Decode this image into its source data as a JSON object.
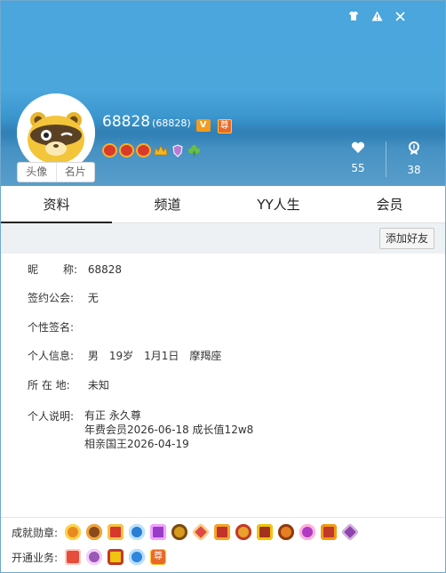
{
  "header": {
    "nickname": "68828",
    "yy_id": "(68828)",
    "v_badge": "V",
    "zun_badge": "尊",
    "likes": "55",
    "fans": "38",
    "avatar_tab_label": "头像",
    "card_tab_label": "名片"
  },
  "tabs": [
    "资料",
    "频道",
    "YY人生",
    "会员"
  ],
  "toolbar": {
    "add_friend_label": "添加好友"
  },
  "profile": {
    "nickname_label": "昵称：",
    "nickname_label_a": "昵",
    "nickname_label_b": "称:",
    "nickname_value": "68828",
    "guild_label": "签约公会:",
    "guild_value": "无",
    "signature_label": "个性签名:",
    "signature_value": "",
    "personal_label": "个人信息:",
    "gender": "男",
    "age": "19岁",
    "birthday": "1月1日",
    "zodiac": "摩羯座",
    "location_label": "所 在 地:",
    "location_value": "未知",
    "desc_label": "个人说明:",
    "desc_lines": [
      "有正 永久尊",
      "年费会员2026-06-18  成长值12w8",
      "相亲国王2026-04-19"
    ]
  },
  "footer": {
    "medals_label": "成就勋章:",
    "services_label": "开通业务:",
    "services_zun": "尊"
  },
  "colors": {
    "header_top": "#4aa6dc",
    "accent": "#f29b1d"
  }
}
